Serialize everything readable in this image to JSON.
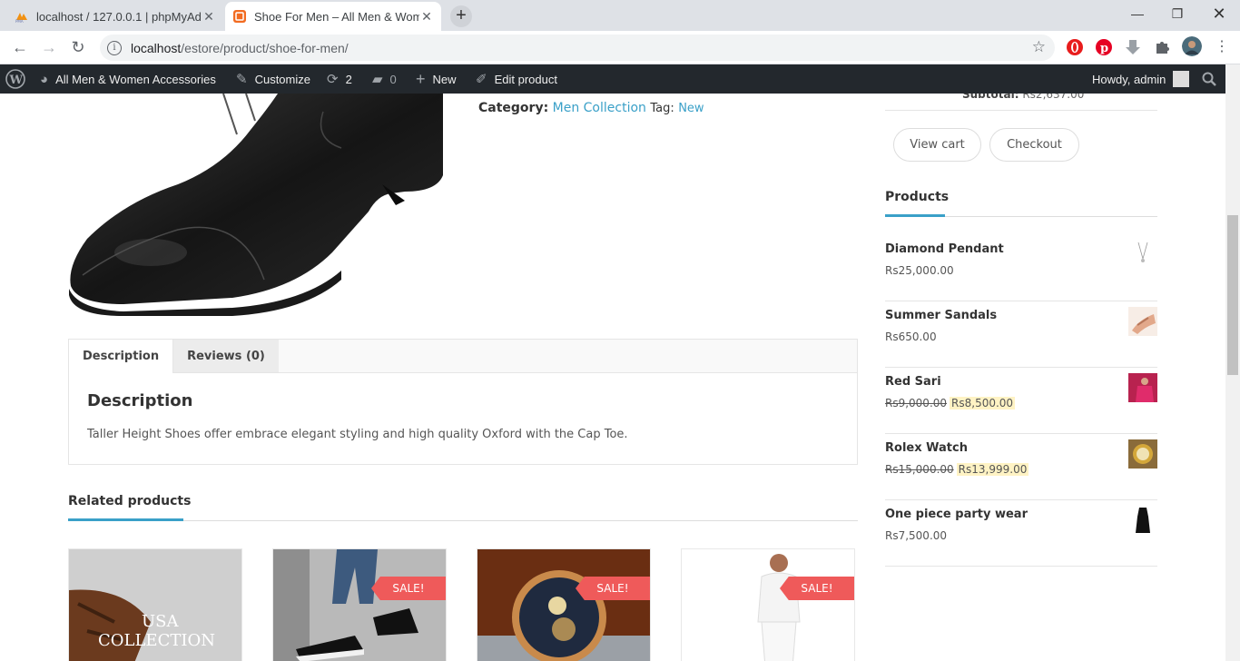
{
  "browser": {
    "tabs": [
      {
        "title": "localhost / 127.0.0.1 | phpMyAdm"
      },
      {
        "title": "Shoe For Men – All Men & Wome"
      }
    ],
    "url_host": "localhost",
    "url_path": "/estore/product/shoe-for-men/"
  },
  "adminbar": {
    "site": "All Men & Women Accessories",
    "customize": "Customize",
    "updates": "2",
    "comments": "0",
    "new": "New",
    "edit": "Edit product",
    "howdy": "Howdy, admin"
  },
  "product": {
    "category_label": "Category:",
    "category": "Men Collection",
    "tag_label": "Tag:",
    "tag": "New"
  },
  "tabs": {
    "description": "Description",
    "reviews": "Reviews (0)",
    "heading": "Description",
    "text": "Taller Height Shoes offer embrace elegant styling and high quality Oxford with the Cap Toe."
  },
  "related": {
    "heading": "Related products",
    "card1_text_a": "USA",
    "card1_text_b": "COLLECTION",
    "sale": "SALE!"
  },
  "cart": {
    "subtotal_label": "Subtotal:",
    "subtotal": "Rs2,637.00",
    "view_cart": "View cart",
    "checkout": "Checkout"
  },
  "widget": {
    "title": "Products",
    "items": [
      {
        "name": "Diamond Pendant",
        "price": "Rs25,000.00"
      },
      {
        "name": "Summer Sandals",
        "price": "Rs650.00"
      },
      {
        "name": "Red Sari",
        "old_price": "Rs9,000.00",
        "price": "Rs8,500.00"
      },
      {
        "name": "Rolex Watch",
        "old_price": "Rs15,000.00",
        "price": "Rs13,999.00"
      },
      {
        "name": "One piece party wear",
        "price": "Rs7,500.00"
      }
    ]
  },
  "colors": {
    "accent": "#3aa0c8",
    "sale": "#ef5a5a",
    "adminbar": "#23282d"
  }
}
